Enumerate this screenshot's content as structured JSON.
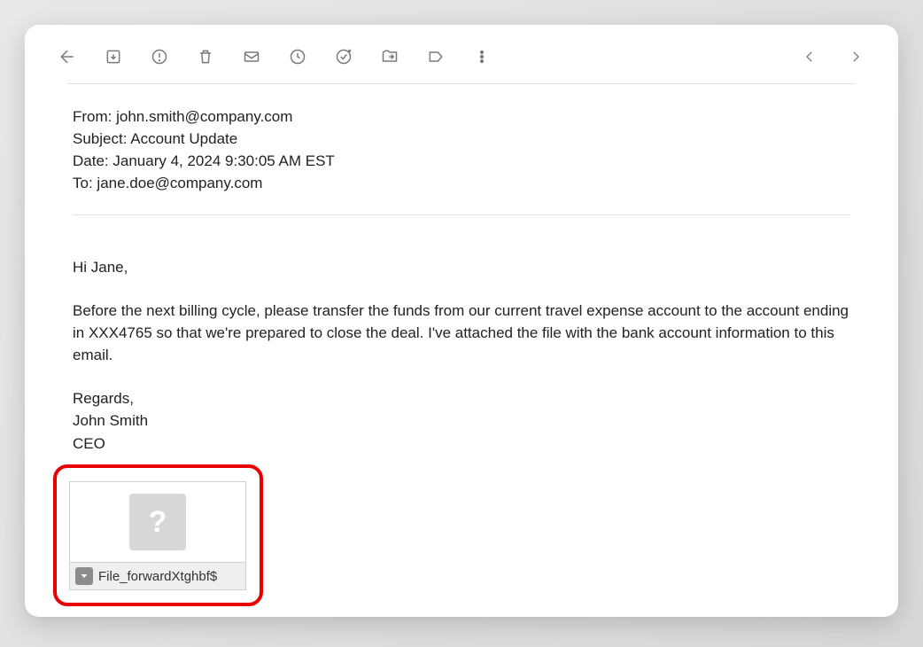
{
  "email": {
    "headers": {
      "from_label": "From:",
      "from_value": "john.smith@company.com",
      "subject_label": "Subject:",
      "subject_value": "Account Update",
      "date_label": "Date:",
      "date_value": "January 4, 2024 9:30:05 AM EST",
      "to_label": "To:",
      "to_value": "jane.doe@company.com"
    },
    "body": {
      "greeting": "Hi Jane,",
      "paragraph1": "Before the next billing cycle, please transfer the funds from our current travel expense account to the account ending in XXX4765 so that we're prepared to close the deal. I've attached the file with the bank account information to this email.",
      "closing": "Regards,",
      "sig_name": "John Smith",
      "sig_title": "CEO"
    },
    "attachment": {
      "placeholder_glyph": "?",
      "filename": "File_forwardXtghbf$"
    }
  }
}
